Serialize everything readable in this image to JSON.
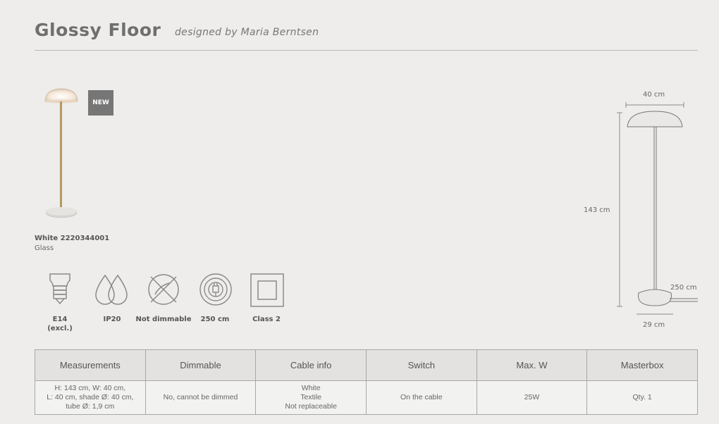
{
  "header": {
    "title": "Glossy Floor",
    "designer": "designed by Maria Berntsen"
  },
  "badge": "NEW",
  "product": {
    "variant": "White 2220344001",
    "material": "Glass"
  },
  "features": [
    {
      "icon": "bulb-e14-icon",
      "label_line1": "E14",
      "label_line2": "(excl.)"
    },
    {
      "icon": "water-drops-icon",
      "label_line1": "IP20",
      "label_line2": ""
    },
    {
      "icon": "not-dimmable-icon",
      "label_line1": "Not dimmable",
      "label_line2": ""
    },
    {
      "icon": "cable-plug-icon",
      "label_line1": "250 cm",
      "label_line2": ""
    },
    {
      "icon": "class2-double-square-icon",
      "label_line1": "Class 2",
      "label_line2": ""
    }
  ],
  "dimensions": {
    "shade_width": "40 cm",
    "height": "143 cm",
    "cable": "250 cm",
    "base_width": "29 cm"
  },
  "specs": {
    "headers": [
      "Measurements",
      "Dimmable",
      "Cable info",
      "Switch",
      "Max. W",
      "Masterbox"
    ],
    "measurements": [
      "H: 143 cm, W: 40 cm,",
      "L: 40 cm, shade Ø: 40 cm,",
      "tube Ø: 1,9 cm"
    ],
    "dimmable": "No, cannot be dimmed",
    "cable_info": [
      "White",
      "Textile",
      "Not replaceable"
    ],
    "switch": "On the cable",
    "max_w": "25W",
    "masterbox": "Qty. 1"
  },
  "colors": {
    "background": "#eeedeb",
    "badge": "#767676",
    "brass": "#b8995f"
  }
}
